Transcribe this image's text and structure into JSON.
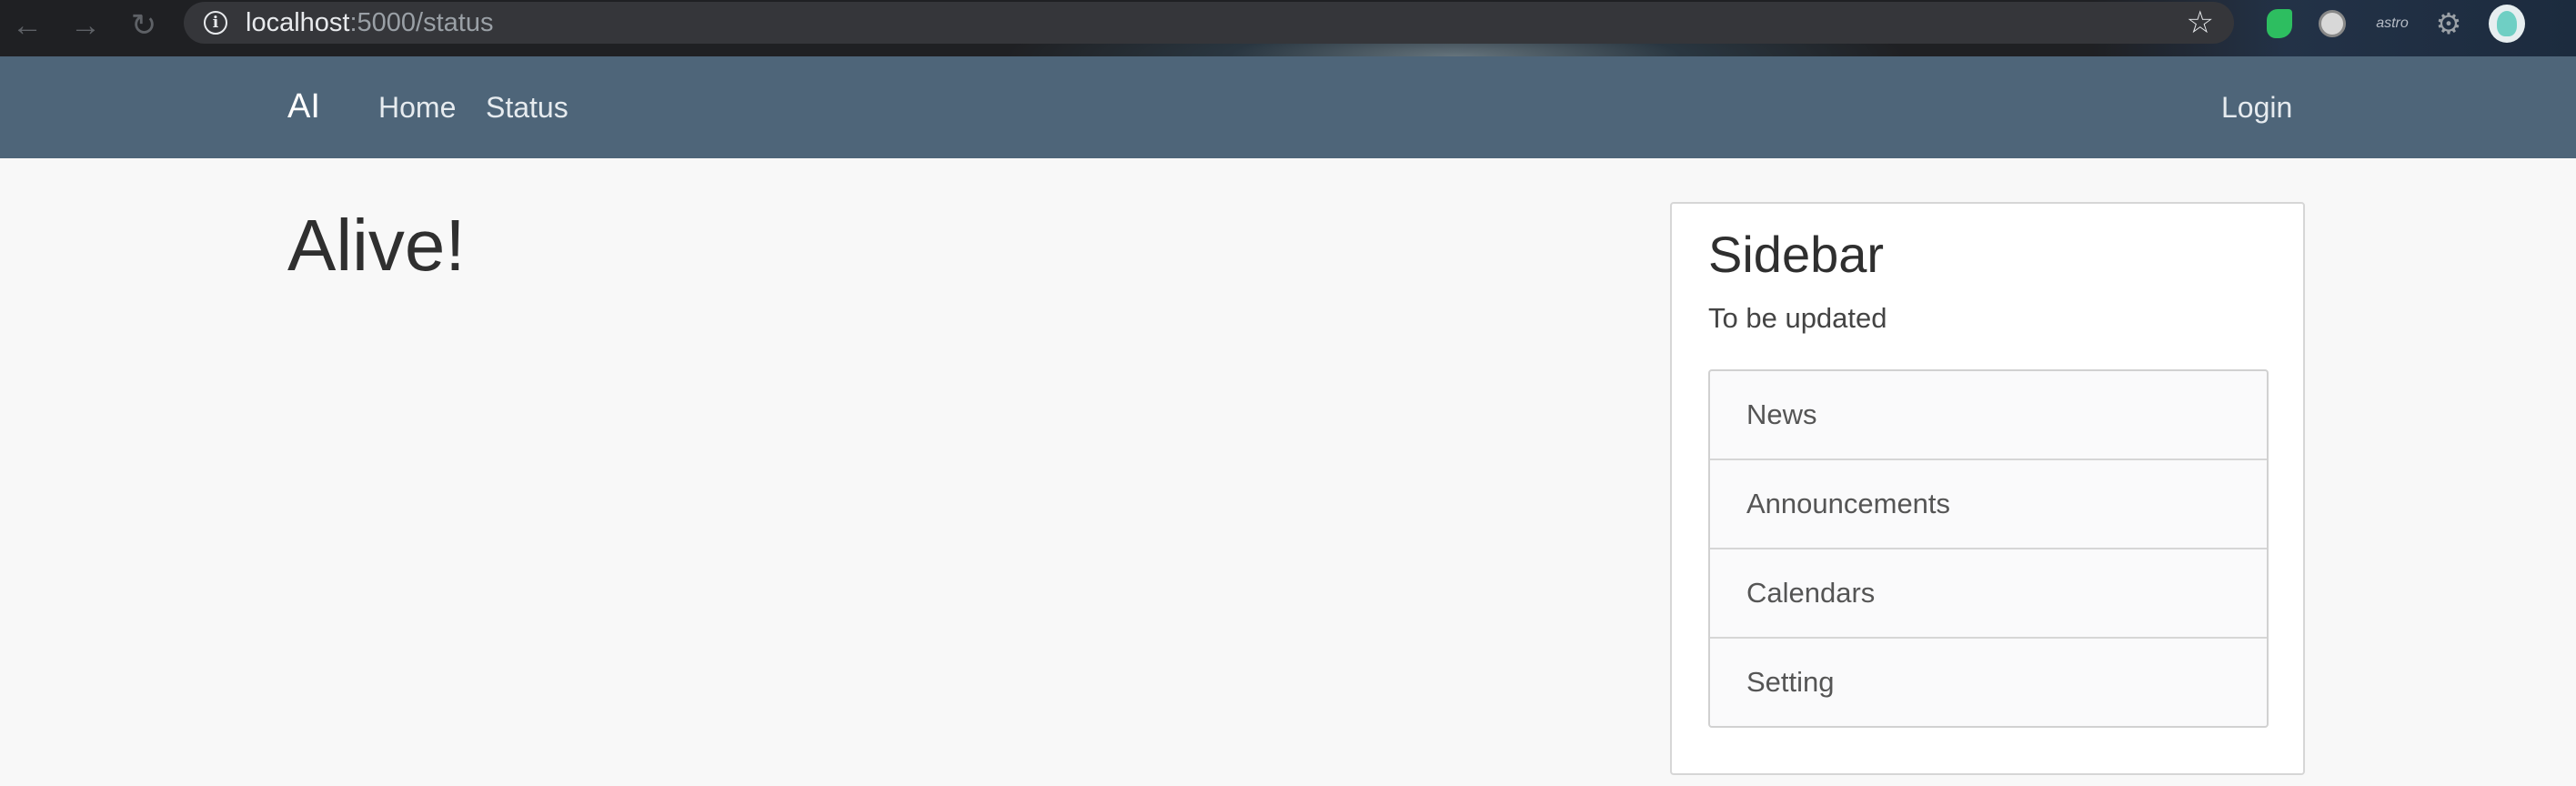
{
  "browser": {
    "url_host": "localhost",
    "url_path": ":5000/status",
    "extensions": [
      "evernote-icon",
      "ghost-icon",
      "astro",
      "puzzle-icon",
      "profile-avatar"
    ],
    "astro_label": "astro"
  },
  "navbar": {
    "brand": "AI",
    "links": [
      "Home",
      "Status"
    ],
    "login": "Login",
    "background": "#4e6579"
  },
  "main": {
    "title": "Alive!"
  },
  "sidebar": {
    "title": "Sidebar",
    "subtitle": "To be updated",
    "items": [
      "News",
      "Announcements",
      "Calendars",
      "Setting"
    ]
  }
}
